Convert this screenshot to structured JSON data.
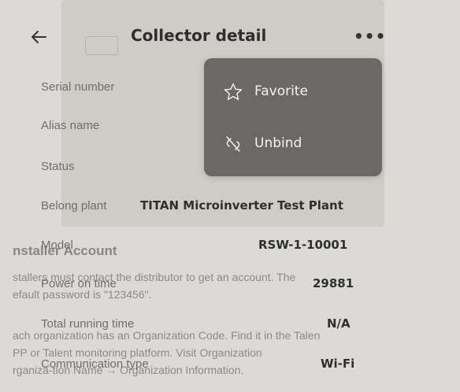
{
  "header": {
    "title": "Collector detail"
  },
  "menu": {
    "items": [
      {
        "label": "Favorite",
        "icon": "star-icon"
      },
      {
        "label": "Unbind",
        "icon": "unbind-icon"
      }
    ]
  },
  "details": {
    "serial_number_label": "Serial number",
    "alias_name_label": "Alias name",
    "status_label": "Status",
    "belong_plant_label": "Belong plant",
    "belong_plant_value": "TITAN Microinverter Test Plant",
    "model_label": "Model",
    "model_value": "RSW-1-10001",
    "power_on_time_label": "Power on time",
    "power_on_time_value": "29881",
    "total_running_time_label": "Total running time",
    "total_running_time_value": "N/A",
    "communication_type_label": "Communication type",
    "communication_type_value": "Wi-Fi"
  },
  "background_print": {
    "heading": "nstaller Account",
    "line1": "stallers must contact the distributor to get an account. The",
    "line2": "efault password is \"123456\".",
    "line3": "ach organization has an Organization Code. Find it in the Talen",
    "line4": "PP or Talent monitoring platform. Visit Organization",
    "line5": "rganiza-tion Name → Organization Information."
  },
  "colors": {
    "background": "#dcdad6",
    "menu_background": "#6b6966",
    "menu_text": "#f2f2f2",
    "label_text": "#6e6e6e",
    "value_text": "#2f2f2f"
  }
}
